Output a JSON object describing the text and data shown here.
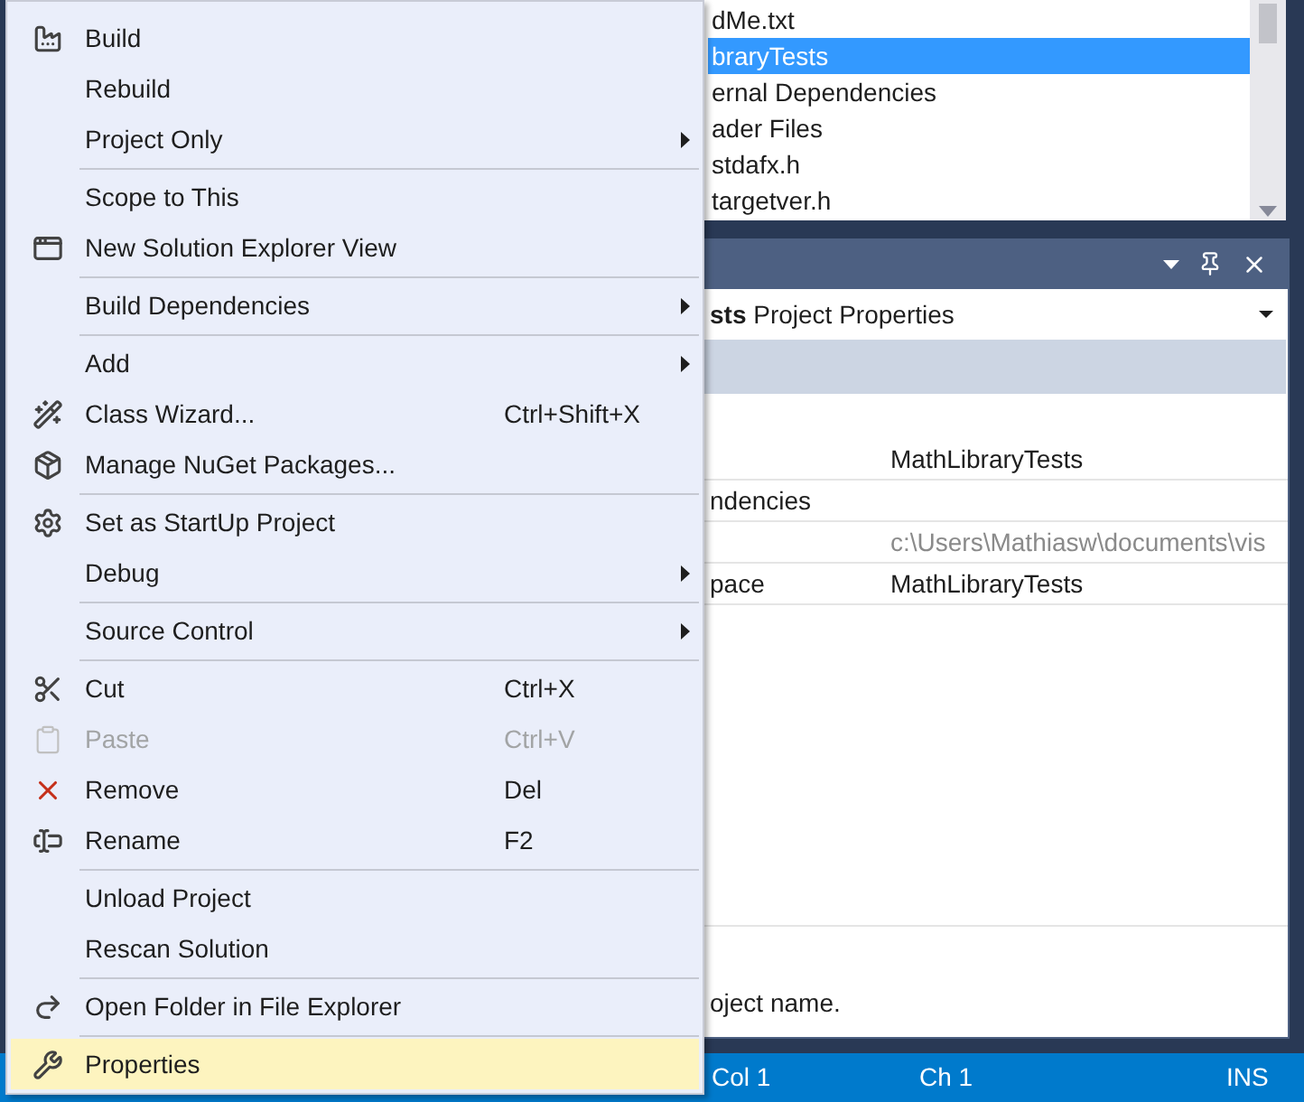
{
  "solution_explorer": {
    "items": [
      {
        "label": "dMe.txt",
        "selected": false
      },
      {
        "label": "braryTests",
        "selected": true
      },
      {
        "label": "ernal Dependencies",
        "selected": false
      },
      {
        "label": "ader Files",
        "selected": false
      },
      {
        "label": "stdafx.h",
        "selected": false
      },
      {
        "label": "targetver.h",
        "selected": false
      }
    ]
  },
  "properties": {
    "object_name": "sts",
    "object_type": "Project Properties",
    "rows": [
      {
        "value": "MathLibraryTests",
        "readonly": false
      },
      {
        "name": "ndencies"
      },
      {
        "value": "c:\\Users\\Mathiasw\\documents\\vis",
        "readonly": true
      },
      {
        "name": "pace",
        "value": "MathLibraryTests",
        "readonly": false
      }
    ],
    "description": "oject name."
  },
  "status_bar": [
    "Col 1",
    "Ch 1",
    "INS"
  ],
  "context_menu": {
    "groups": [
      [
        {
          "label": "Build",
          "submenu": false,
          "disabled": false,
          "selected": false
        },
        {
          "label": "Rebuild",
          "submenu": false,
          "disabled": false,
          "selected": false
        },
        {
          "label": "Project Only",
          "submenu": true,
          "disabled": false,
          "selected": false
        }
      ],
      [
        {
          "label": "Scope to This",
          "submenu": false,
          "disabled": false,
          "selected": false
        },
        {
          "label": "New Solution Explorer View",
          "submenu": false,
          "disabled": false,
          "selected": false
        }
      ],
      [
        {
          "label": "Build Dependencies",
          "submenu": true,
          "disabled": false,
          "selected": false
        }
      ],
      [
        {
          "label": "Add",
          "submenu": true,
          "disabled": false,
          "selected": false
        },
        {
          "label": "Class Wizard...",
          "shortcut": "Ctrl+Shift+X",
          "submenu": false,
          "disabled": false,
          "selected": false
        },
        {
          "label": "Manage NuGet Packages...",
          "submenu": false,
          "disabled": false,
          "selected": false
        }
      ],
      [
        {
          "label": "Set as StartUp Project",
          "submenu": false,
          "disabled": false,
          "selected": false
        },
        {
          "label": "Debug",
          "submenu": true,
          "disabled": false,
          "selected": false
        }
      ],
      [
        {
          "label": "Source Control",
          "submenu": true,
          "disabled": false,
          "selected": false
        }
      ],
      [
        {
          "label": "Cut",
          "shortcut": "Ctrl+X",
          "submenu": false,
          "disabled": false,
          "selected": false
        },
        {
          "label": "Paste",
          "shortcut": "Ctrl+V",
          "submenu": false,
          "disabled": true,
          "selected": false
        },
        {
          "label": "Remove",
          "shortcut": "Del",
          "submenu": false,
          "disabled": false,
          "selected": false
        },
        {
          "label": "Rename",
          "shortcut": "F2",
          "submenu": false,
          "disabled": false,
          "selected": false
        }
      ],
      [
        {
          "label": "Unload Project",
          "submenu": false,
          "disabled": false,
          "selected": false
        },
        {
          "label": "Rescan Solution",
          "submenu": false,
          "disabled": false,
          "selected": false
        }
      ],
      [
        {
          "label": "Open Folder in File Explorer",
          "submenu": false,
          "disabled": false,
          "selected": false
        }
      ],
      [
        {
          "label": "Properties",
          "submenu": false,
          "disabled": false,
          "selected": true
        }
      ]
    ]
  }
}
